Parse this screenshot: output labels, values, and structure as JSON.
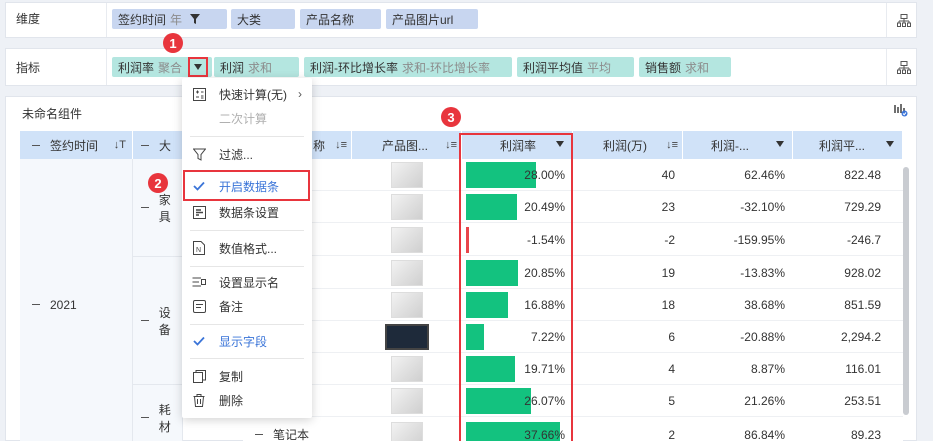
{
  "dimension_bar": {
    "label": "维度",
    "fields": [
      {
        "name": "签约时间",
        "sub": "年",
        "has_filter": true
      },
      {
        "name": "大类",
        "sub": ""
      },
      {
        "name": "产品名称",
        "sub": ""
      },
      {
        "name": "产品图片url",
        "sub": ""
      }
    ]
  },
  "indicator_bar": {
    "label": "指标",
    "fields": [
      {
        "name": "利润率",
        "sub": "聚合"
      },
      {
        "name": "利润",
        "sub": "求和"
      },
      {
        "name": "利润-环比增长率",
        "sub": "求和-环比增长率"
      },
      {
        "name": "利润平均值",
        "sub": "平均"
      },
      {
        "name": "销售额",
        "sub": "求和"
      }
    ]
  },
  "widget": {
    "title": "未命名组件",
    "columns": [
      {
        "label": "签约时间",
        "sort": "↓T"
      },
      {
        "label": "大",
        "sort": ""
      },
      {
        "label": "称",
        "sort": "↓≡"
      },
      {
        "label": "产品图...",
        "sort": "↓≡"
      },
      {
        "label": "利润率",
        "sort": ""
      },
      {
        "label": "利润(万)",
        "sort": "↓≡"
      },
      {
        "label": "利润-...",
        "sort": ""
      },
      {
        "label": "利润平...",
        "sort": ""
      }
    ],
    "year": "2021",
    "categories": [
      "家具",
      "设备",
      "耗材"
    ],
    "last_product": "笔记本",
    "rows": [
      {
        "rate": "28.00%",
        "rate_value": 28.0,
        "profit": "40",
        "growth": "62.46%",
        "avg": "822.48"
      },
      {
        "rate": "20.49%",
        "rate_value": 20.49,
        "profit": "23",
        "growth": "-32.10%",
        "avg": "729.29"
      },
      {
        "rate": "-1.54%",
        "rate_value": -1.54,
        "profit": "-2",
        "growth": "-159.95%",
        "avg": "-246.7"
      },
      {
        "rate": "20.85%",
        "rate_value": 20.85,
        "profit": "19",
        "growth": "-13.83%",
        "avg": "928.02"
      },
      {
        "rate": "16.88%",
        "rate_value": 16.88,
        "profit": "18",
        "growth": "38.68%",
        "avg": "851.59"
      },
      {
        "rate": "7.22%",
        "rate_value": 7.22,
        "profit": "6",
        "growth": "-20.88%",
        "avg": "2,294.2"
      },
      {
        "rate": "19.71%",
        "rate_value": 19.71,
        "profit": "4",
        "growth": "8.87%",
        "avg": "116.01"
      },
      {
        "rate": "26.07%",
        "rate_value": 26.07,
        "profit": "5",
        "growth": "21.26%",
        "avg": "253.51"
      },
      {
        "rate": "37.66%",
        "rate_value": 37.66,
        "profit": "2",
        "growth": "86.84%",
        "avg": "89.23"
      }
    ]
  },
  "menu": {
    "items": [
      {
        "label": "快速计算(无)",
        "icon": "quick-calc-icon",
        "state": "normal",
        "submenu": true
      },
      {
        "label": "二次计算",
        "icon": "",
        "state": "disabled"
      },
      {
        "label": "过滤...",
        "icon": "filter-icon",
        "state": "normal"
      },
      {
        "label": "开启数据条",
        "icon": "check-icon",
        "state": "active"
      },
      {
        "label": "数据条设置",
        "icon": "databar-settings-icon",
        "state": "normal"
      },
      {
        "label": "数值格式...",
        "icon": "number-format-icon",
        "state": "normal"
      },
      {
        "label": "设置显示名",
        "icon": "display-name-icon",
        "state": "normal"
      },
      {
        "label": "备注",
        "icon": "note-icon",
        "state": "normal"
      },
      {
        "label": "显示字段",
        "icon": "check-icon",
        "state": "active"
      },
      {
        "label": "复制",
        "icon": "copy-icon",
        "state": "normal"
      },
      {
        "label": "删除",
        "icon": "delete-icon",
        "state": "normal"
      }
    ]
  },
  "badges": [
    "1",
    "2",
    "3"
  ],
  "colors": {
    "positive_bar": "#13c27f",
    "negative_bar": "#e8454b",
    "highlight": "#e8353d",
    "accent": "#3a74d8"
  }
}
